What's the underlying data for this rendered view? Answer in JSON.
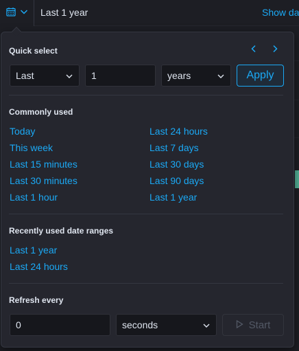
{
  "topbar": {
    "range_text": "Last 1 year",
    "show_dates_label": "Show dates",
    "calendar_icon": "calendar-icon",
    "menu_chevron_icon": "chevron-down-icon"
  },
  "quick_select": {
    "title": "Quick select",
    "prev_icon": "chevron-left-icon",
    "next_icon": "chevron-right-icon",
    "tense": "Last",
    "value": "1",
    "unit": "years",
    "apply_label": "Apply"
  },
  "commonly_used": {
    "title": "Commonly used",
    "left": [
      "Today",
      "This week",
      "Last 15 minutes",
      "Last 30 minutes",
      "Last 1 hour"
    ],
    "right": [
      "Last 24 hours",
      "Last 7 days",
      "Last 30 days",
      "Last 90 days",
      "Last 1 year"
    ]
  },
  "recently_used": {
    "title": "Recently used date ranges",
    "items": [
      "Last 1 year",
      "Last 24 hours"
    ]
  },
  "refresh": {
    "title": "Refresh every",
    "value": "0",
    "unit": "seconds",
    "start_label": "Start",
    "start_icon": "play-icon"
  },
  "colors": {
    "accent": "#1ba9f5",
    "panel": "#25262e",
    "input_bg": "#16171c",
    "text": "#dfe5ef",
    "green_marker": "#54b399"
  }
}
